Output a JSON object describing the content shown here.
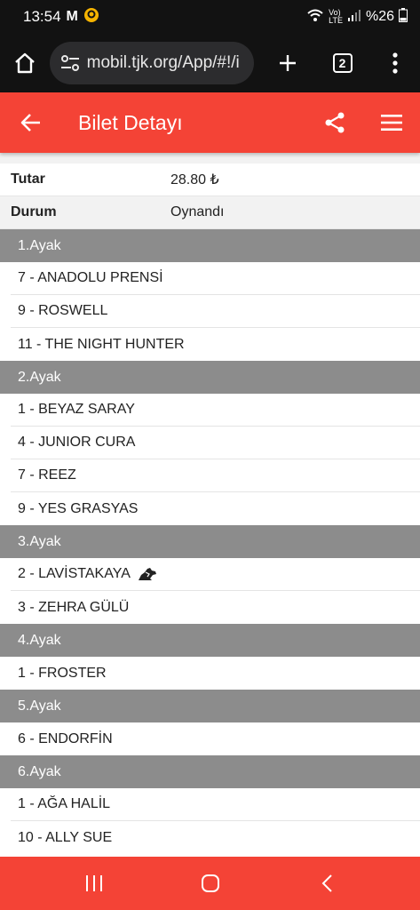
{
  "status": {
    "time": "13:54",
    "battery": "%26"
  },
  "browser": {
    "url": "mobil.tjk.org/App/#!/i",
    "tab_count": "2"
  },
  "header": {
    "title": "Bilet Detayı"
  },
  "info": [
    {
      "label": "Tutar",
      "value": "28.80 ₺"
    },
    {
      "label": "Durum",
      "value": "Oynandı"
    }
  ],
  "legs": [
    {
      "title": "1.Ayak",
      "horses": [
        {
          "name": "7 - ANADOLU PRENSİ"
        },
        {
          "name": "9 - ROSWELL"
        },
        {
          "name": "11 - THE NIGHT HUNTER"
        }
      ]
    },
    {
      "title": "2.Ayak",
      "horses": [
        {
          "name": "1 - BEYAZ SARAY"
        },
        {
          "name": "4 - JUNIOR CURA"
        },
        {
          "name": "7 - REEZ"
        },
        {
          "name": "9 - YES GRASYAS"
        }
      ]
    },
    {
      "title": "3.Ayak",
      "horses": [
        {
          "name": "2 - LAVİSTAKAYA",
          "winner_icon": true
        },
        {
          "name": "3 - ZEHRA GÜLÜ"
        }
      ]
    },
    {
      "title": "4.Ayak",
      "horses": [
        {
          "name": "1 - FROSTER"
        }
      ]
    },
    {
      "title": "5.Ayak",
      "horses": [
        {
          "name": "6 - ENDORFİN"
        }
      ]
    },
    {
      "title": "6.Ayak",
      "horses": [
        {
          "name": "1 - AĞA HALİL"
        },
        {
          "name": "10 - ALLY SUE"
        }
      ]
    }
  ],
  "colors": {
    "accent": "#f44336",
    "leg_header": "#8c8c8c",
    "status_bar": "#121212"
  }
}
